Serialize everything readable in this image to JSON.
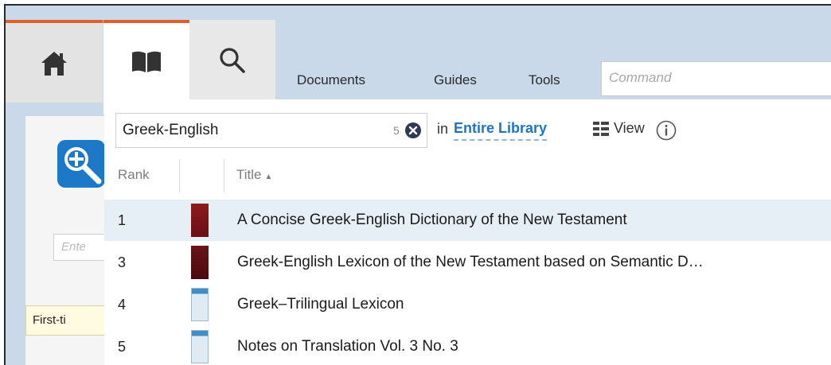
{
  "toolbar": {
    "documents": "Documents",
    "guides": "Guides",
    "tools": "Tools",
    "command_placeholder": "Command"
  },
  "behind_panel": {
    "input_placeholder": "Ente",
    "button_label": "First-ti"
  },
  "search": {
    "query": "Greek-English",
    "result_count": "5",
    "in_label": "in",
    "scope": "Entire Library",
    "view_label": "View"
  },
  "table": {
    "columns": {
      "rank": "Rank",
      "title": "Title"
    },
    "rows": [
      {
        "rank": "1",
        "title": "A Concise Greek-English Dictionary of the New Testament",
        "cover": "red",
        "selected": true
      },
      {
        "rank": "3",
        "title": "Greek-English Lexicon of the New Testament based on Semantic D…",
        "cover": "dark",
        "selected": false
      },
      {
        "rank": "4",
        "title": "Greek–Trilingual Lexicon",
        "cover": "pale",
        "selected": false
      },
      {
        "rank": "5",
        "title": "Notes on Translation Vol. 3 No. 3",
        "cover": "pale",
        "selected": false
      }
    ]
  },
  "colors": {
    "accent": "#e0602b",
    "link": "#1e74c4",
    "selected_row": "#e6eef6",
    "topbar": "#c9d9ea"
  },
  "icons": {
    "home": "home-icon",
    "library": "book-icon",
    "search": "search-icon",
    "clear": "clear-circle-icon",
    "view": "grid-view-icon",
    "info": "info-icon",
    "sort": "sort-ascending-icon"
  }
}
